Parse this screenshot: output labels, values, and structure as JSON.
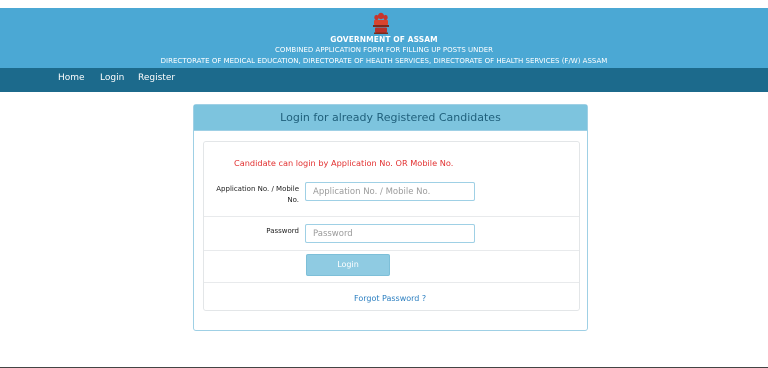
{
  "header": {
    "title": "GOVERNMENT OF ASSAM",
    "subtitle": "COMBINED APPLICATION FORM FOR FILLING UP POSTS UNDER",
    "directorates": "DIRECTORATE OF MEDICAL EDUCATION, DIRECTORATE OF HEALTH SERVICES, DIRECTORATE OF HEALTH SERVICES (F/W) ASSAM",
    "emblem_icon": "national-emblem-icon",
    "bg_color": "#4ba8d4"
  },
  "nav": {
    "bg_color": "#1c6a8c",
    "home": "Home",
    "login": "Login",
    "register": "Register"
  },
  "login_card": {
    "heading": "Login for already Registered Candidates",
    "note": "Candidate can login by Application No. OR Mobile No.",
    "app_no_label_line1": "Application No. / Mobile",
    "app_no_label_line2": "No.",
    "app_no_placeholder": "Application No. / Mobile No.",
    "password_label": "Password",
    "password_placeholder": "Password",
    "login_button": "Login",
    "forgot_link": "Forgot Password ?",
    "note_color": "#e23030",
    "link_color": "#2a7ec0"
  }
}
